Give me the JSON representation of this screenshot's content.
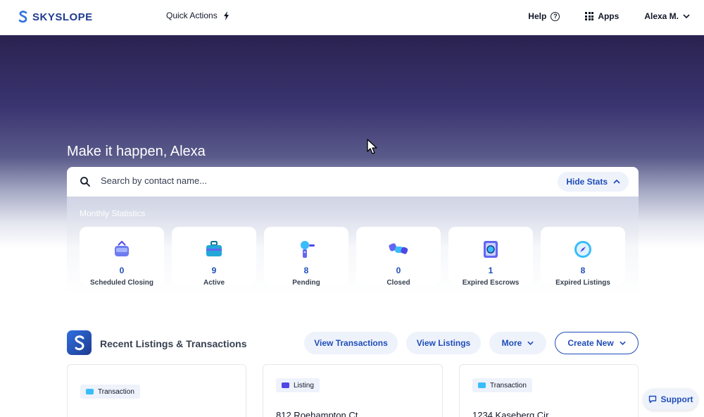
{
  "header": {
    "logo_text": "SKYSLOPE",
    "quick_actions_label": "Quick Actions",
    "help_label": "Help",
    "apps_label": "Apps",
    "user_label": "Alexa M."
  },
  "hero": {
    "title": "Make it happen, Alexa"
  },
  "search": {
    "placeholder": "Search by contact name...",
    "hide_stats_label": "Hide Stats"
  },
  "stats": {
    "section_label": "Monthly Statistics",
    "items": [
      {
        "value": "0",
        "label": "Scheduled Closing",
        "icon": "calendar-bag-icon"
      },
      {
        "value": "9",
        "label": "Active",
        "icon": "briefcase-icon"
      },
      {
        "value": "8",
        "label": "Pending",
        "icon": "hourglass-icon"
      },
      {
        "value": "0",
        "label": "Closed",
        "icon": "handshake-icon"
      },
      {
        "value": "1",
        "label": "Expired Escrows",
        "icon": "magnifier-document-icon"
      },
      {
        "value": "8",
        "label": "Expired Listings",
        "icon": "compass-icon"
      }
    ]
  },
  "recent": {
    "title": "Recent Listings & Transactions",
    "view_transactions_label": "View Transactions",
    "view_listings_label": "View Listings",
    "more_label": "More",
    "create_new_label": "Create New",
    "cards": [
      {
        "tag": "Transaction",
        "address": ""
      },
      {
        "tag": "Listing",
        "address": "812 Roehampton Ct"
      },
      {
        "tag": "Transaction",
        "address": "1234 Kaseberg Cir"
      }
    ]
  },
  "support_label": "Support",
  "colors": {
    "brand_blue": "#1f4db8",
    "logo_blue": "#1f3b8f",
    "pill_bg": "#eef2fb",
    "transaction_tag": "#38bdf8",
    "listing_tag": "#4f46e5"
  }
}
